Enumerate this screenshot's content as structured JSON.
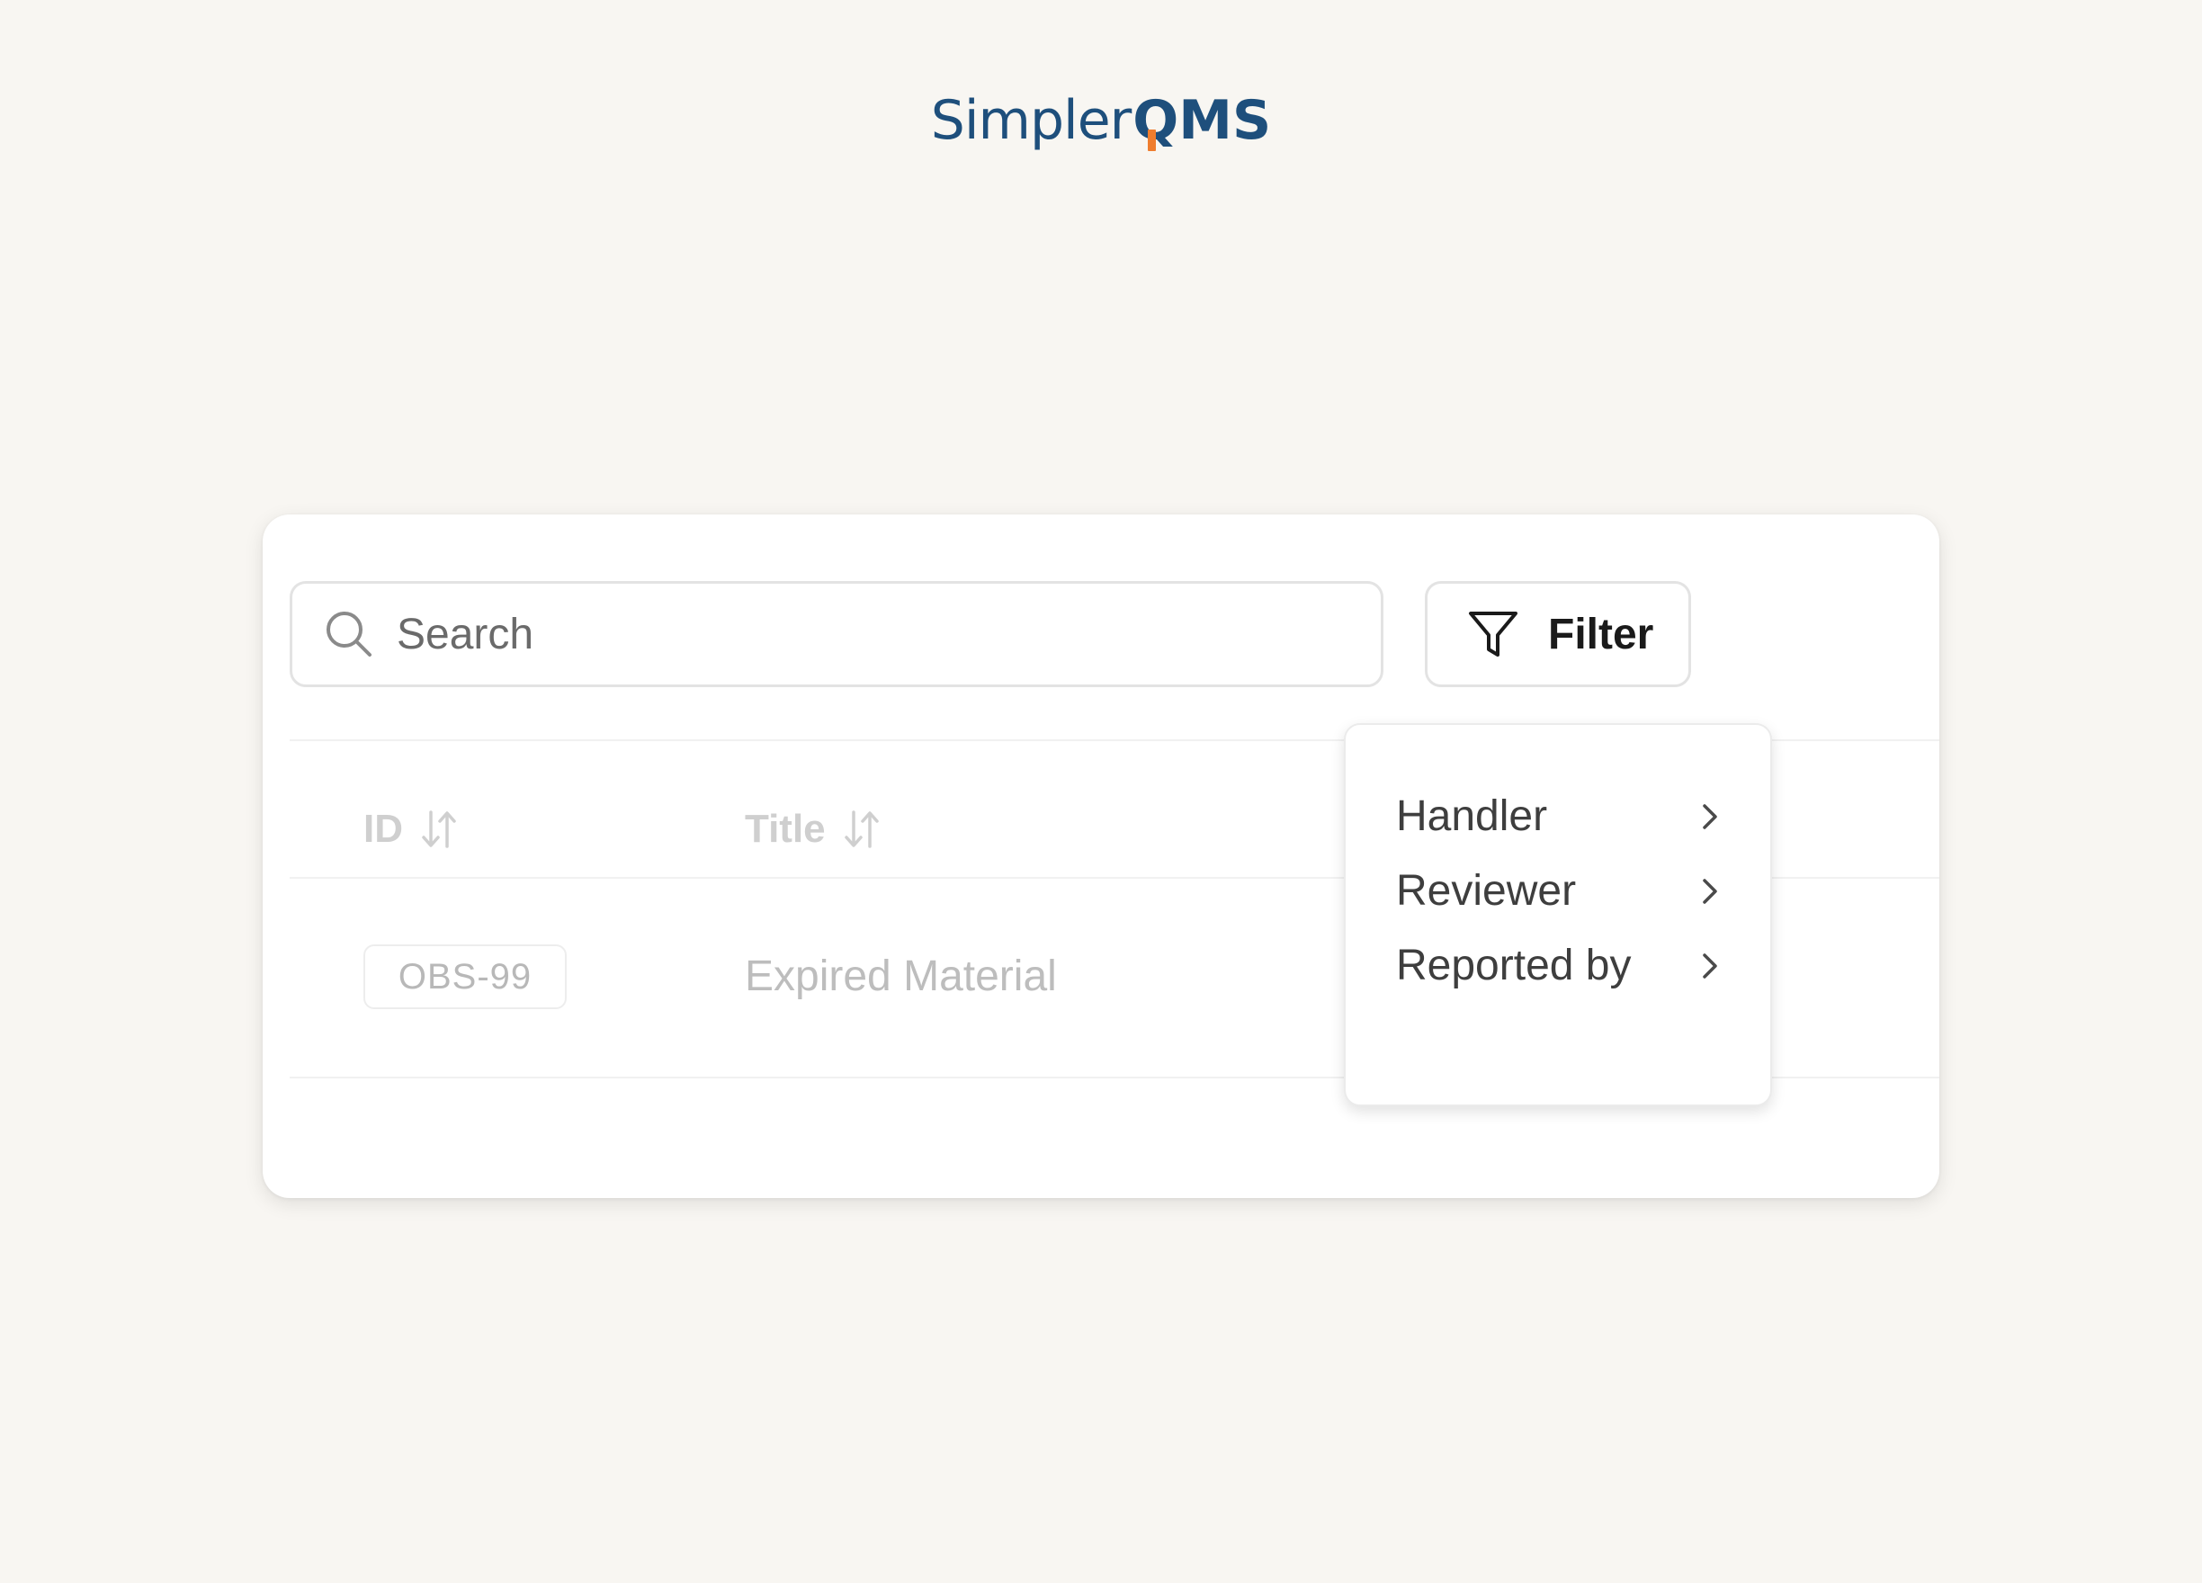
{
  "logo": {
    "part1": "Simpler",
    "part2": "QMS",
    "brand_color": "#1e4f7c",
    "accent_color": "#ef7d2e"
  },
  "search": {
    "placeholder": "Search",
    "icon": "search-icon"
  },
  "filter": {
    "label": "Filter",
    "icon": "funnel-icon"
  },
  "table": {
    "columns": [
      {
        "label": "ID",
        "icon": "sort-icon"
      },
      {
        "label": "Title",
        "icon": "sort-icon"
      }
    ],
    "rows": [
      {
        "id": "OBS-99",
        "title": "Expired Material"
      }
    ]
  },
  "filter_menu": {
    "items": [
      {
        "label": "Handler",
        "icon": "chevron-right-icon"
      },
      {
        "label": "Reviewer",
        "icon": "chevron-right-icon"
      },
      {
        "label": "Reported by",
        "icon": "chevron-right-icon"
      }
    ]
  }
}
